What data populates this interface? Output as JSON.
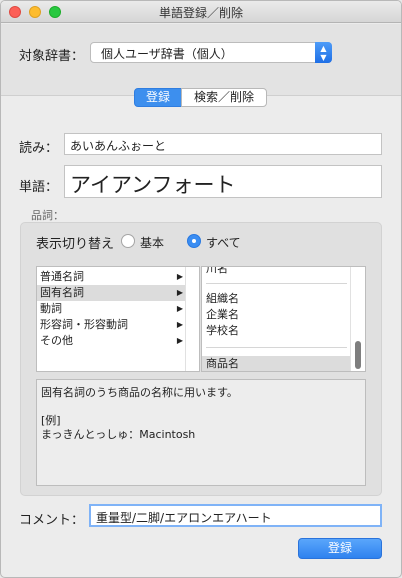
{
  "window": {
    "title": "単語登録／削除"
  },
  "dictionary": {
    "label": "対象辞書：",
    "selected": "個人ユーザ辞書（個人）"
  },
  "tabs": [
    {
      "label": "登録",
      "selected": true
    },
    {
      "label": "検索／削除",
      "selected": false
    }
  ],
  "reading": {
    "label": "読み：",
    "value": "あいあんふぉーと"
  },
  "word": {
    "label": "単語：",
    "value": "アイアンフォート"
  },
  "pos": {
    "label": "品詞：",
    "display_toggle_label": "表示切り替え",
    "radio_basic": "基本",
    "radio_all": "すべて",
    "selected_radio": "すべて",
    "categories": [
      {
        "label": "普通名詞",
        "selected": false
      },
      {
        "label": "固有名詞",
        "selected": true
      },
      {
        "label": "動詞",
        "selected": false
      },
      {
        "label": "形容詞・形容動詞",
        "selected": false
      },
      {
        "label": "その他",
        "selected": false
      }
    ],
    "subcategories": [
      {
        "label": "川名",
        "selected": false
      },
      {
        "label": "組織名",
        "selected": false
      },
      {
        "label": "企業名",
        "selected": false
      },
      {
        "label": "学校名",
        "selected": false
      },
      {
        "label": "商品名",
        "selected": true
      }
    ],
    "description": [
      "固有名詞のうち商品の名称に用います。",
      "[例]",
      "まっきんとっしゅ：Macintosh"
    ]
  },
  "comment": {
    "label": "コメント：",
    "value": "重量型/二脚/エアロンエアハート"
  },
  "register_button": "登録",
  "colors": {
    "accent": "#3d8fee",
    "close": "#fc5f57",
    "minimize": "#fdbc2e",
    "maximize": "#28c840"
  }
}
